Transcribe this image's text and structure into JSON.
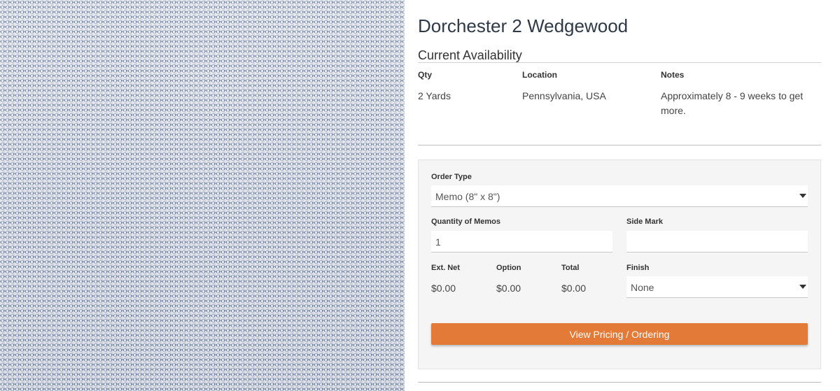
{
  "product": {
    "title": "Dorchester 2 Wedgewood"
  },
  "availability": {
    "heading": "Current Availability",
    "columns": {
      "qty": "Qty",
      "location": "Location",
      "notes": "Notes"
    },
    "row": {
      "qty": "2 Yards",
      "location": "Pennsylvania, USA",
      "notes": "Approximately 8 - 9 weeks to get more."
    }
  },
  "order": {
    "order_type_label": "Order Type",
    "order_type_value": "Memo (8\" x 8\")",
    "quantity_label": "Quantity of Memos",
    "quantity_value": "1",
    "side_mark_label": "Side Mark",
    "side_mark_value": "",
    "ext_net_label": "Ext. Net",
    "ext_net_value": "$0.00",
    "option_label": "Option",
    "option_value": "$0.00",
    "total_label": "Total",
    "total_value": "$0.00",
    "finish_label": "Finish",
    "finish_value": "None",
    "button_label": "View Pricing / Ordering"
  },
  "colors": {
    "accent": "#e37a37",
    "fabric": "#4f6189",
    "panel_bg": "#f5f5f5"
  },
  "icons": {
    "select_caret": "caret-down-icon"
  }
}
